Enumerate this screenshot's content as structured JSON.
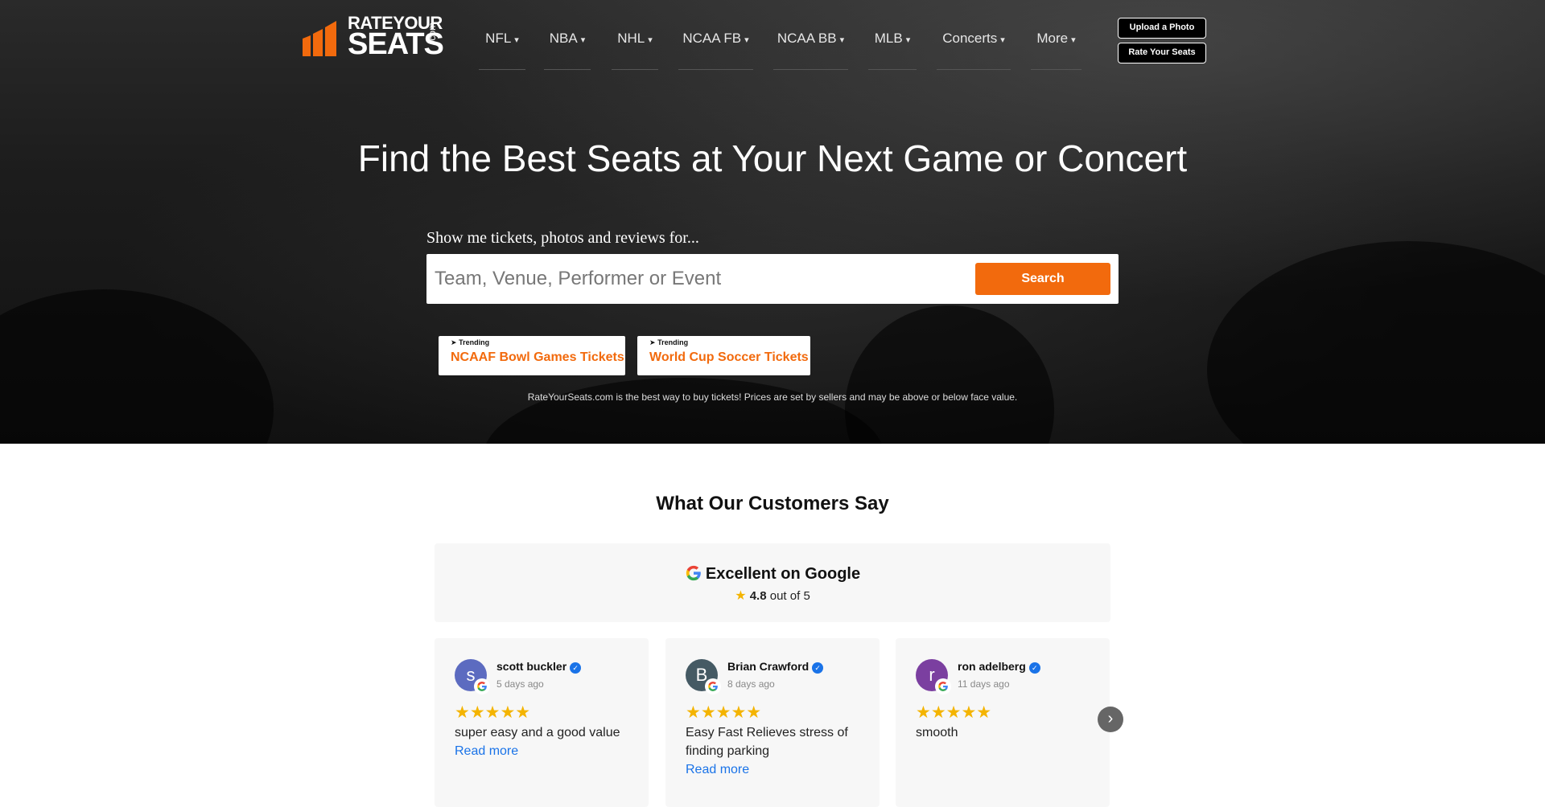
{
  "logo": {
    "rate": "RATEYOUR",
    "seats": "SEATS",
    "dotcom": ".com"
  },
  "nav": {
    "items": [
      {
        "label": "NFL"
      },
      {
        "label": "NBA"
      },
      {
        "label": "NHL"
      },
      {
        "label": "NCAA FB"
      },
      {
        "label": "NCAA BB"
      },
      {
        "label": "MLB"
      },
      {
        "label": "Concerts"
      },
      {
        "label": "More"
      }
    ],
    "caret_icon": "chevron-down-icon",
    "upload_label": "Upload a Photo",
    "rate_label": "Rate Your Seats"
  },
  "hero": {
    "headline": "Find the Best Seats at Your Next Game or Concert",
    "search_label": "Show me tickets, photos and reviews for...",
    "search_placeholder": "Team, Venue, Performer or Event",
    "search_button": "Search",
    "trending": [
      {
        "tag": "Trending",
        "text": "NCAAF Bowl Games Tickets"
      },
      {
        "tag": "Trending",
        "text": "World Cup Soccer Tickets"
      }
    ],
    "disclaimer": "RateYourSeats.com is the best way to buy tickets! Prices are set by sellers and may be above or below face value."
  },
  "reviews": {
    "section_title": "What Our Customers Say",
    "google_title": "Excellent on Google",
    "rating_value": "4.8",
    "rating_suffix": "out of 5",
    "read_more": "Read more",
    "stars": "★★★★★",
    "items": [
      {
        "initial": "s",
        "name": "scott buckler",
        "date": "5 days ago",
        "text": "super easy and a good value",
        "avatar_color": "#5c6bc0"
      },
      {
        "initial": "B",
        "name": "Brian Crawford",
        "date": "8 days ago",
        "text": "Easy Fast Relieves stress of finding parking",
        "avatar_color": "#455a64"
      },
      {
        "initial": "r",
        "name": "ron adelberg",
        "date": "11 days ago",
        "text": "smooth",
        "avatar_color": "#7b3fa0"
      }
    ]
  },
  "colors": {
    "accent": "#f26a0d",
    "link": "#1a73e8",
    "star": "#f4b400"
  }
}
